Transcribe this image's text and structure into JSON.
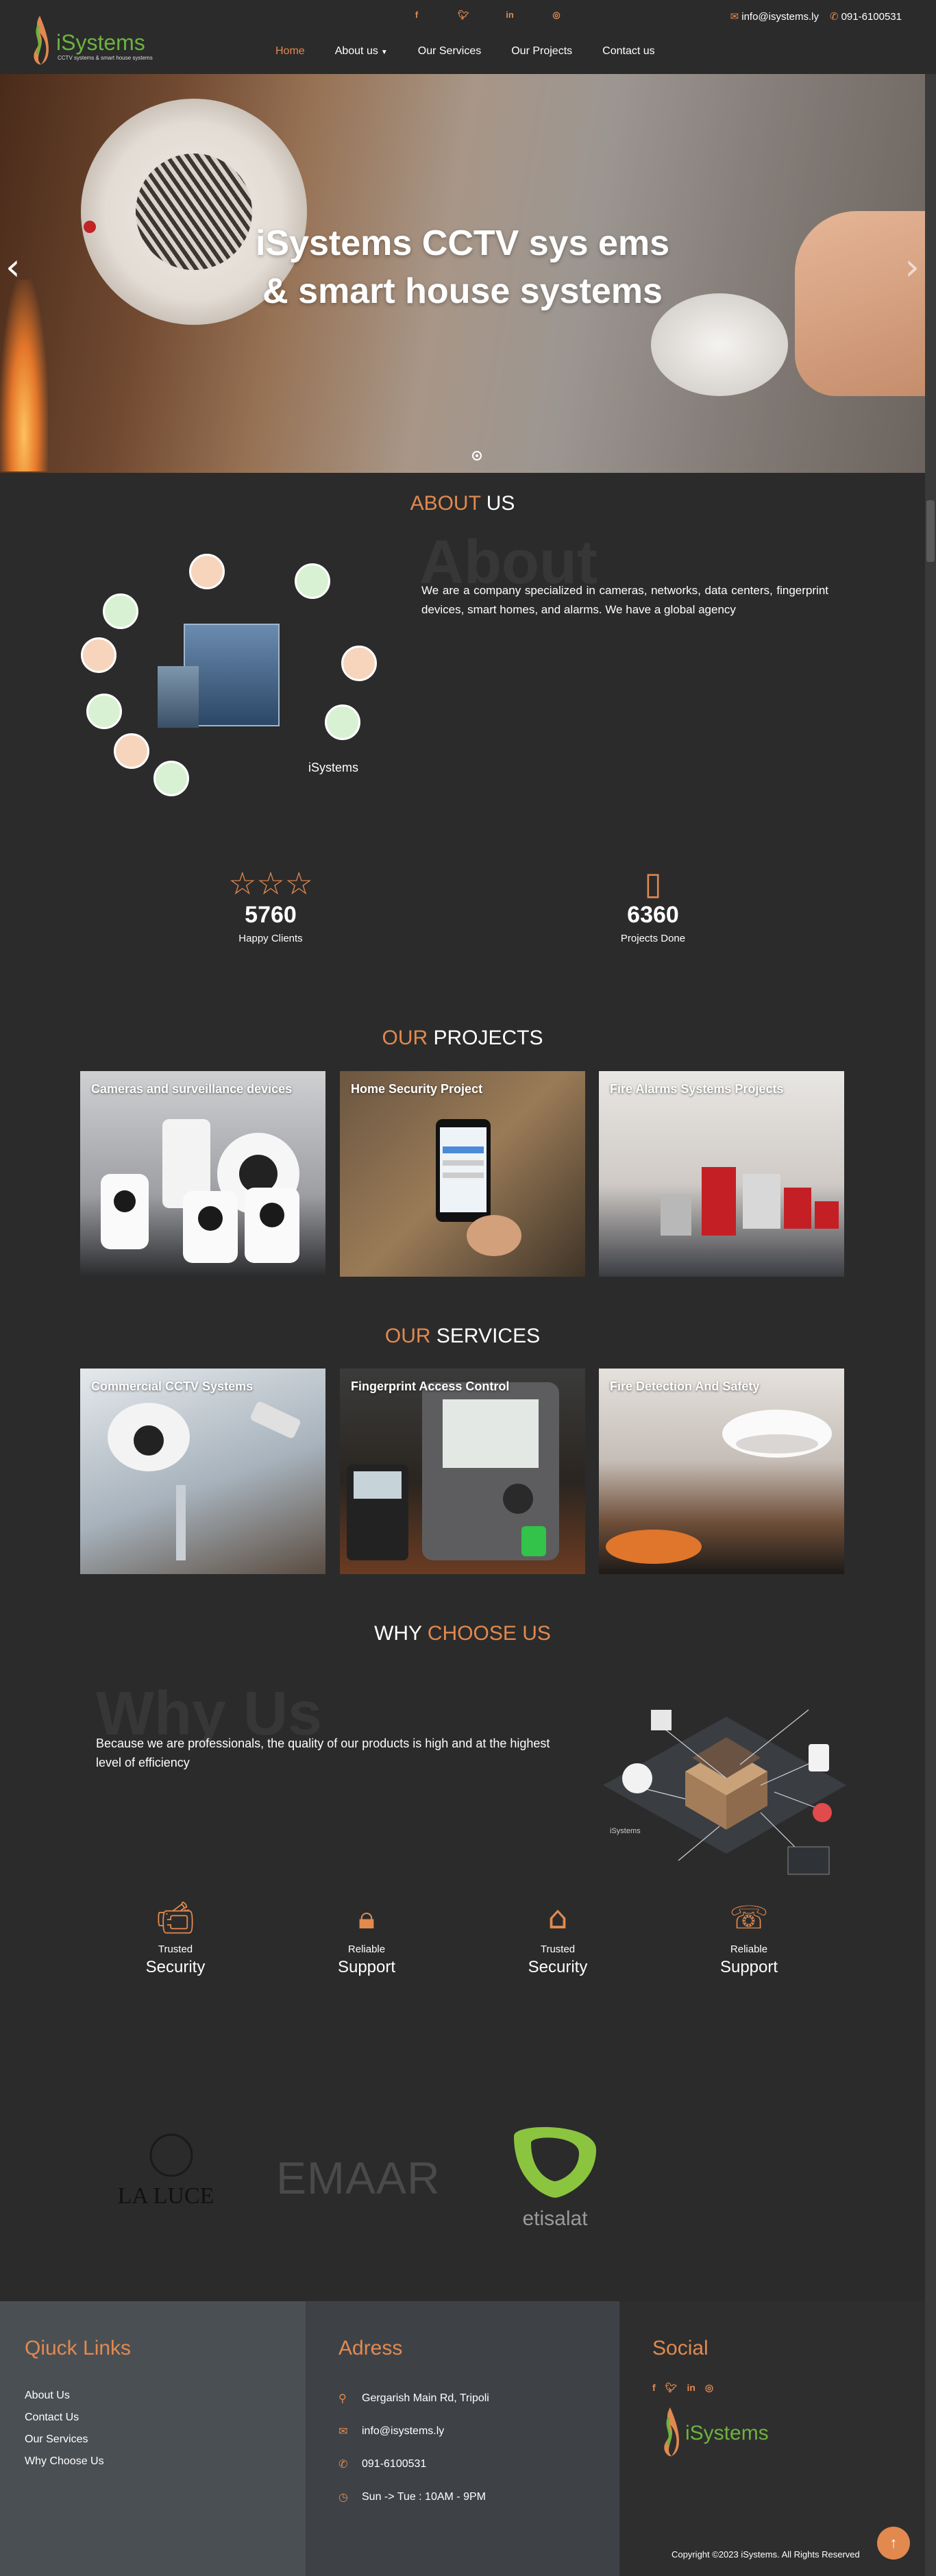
{
  "brand": {
    "name": "iSystems",
    "tagline": "CCTV systems & smart house systems"
  },
  "topbar": {
    "socials": [
      "f",
      "t",
      "in",
      "ig"
    ],
    "email": "info@isystems.ly",
    "phone": "091-6100531"
  },
  "nav": {
    "items": [
      {
        "label": "Home",
        "active": true
      },
      {
        "label": "About us",
        "dropdown": true
      },
      {
        "label": "Our Services"
      },
      {
        "label": "Our Projects"
      },
      {
        "label": "Contact us"
      }
    ]
  },
  "hero": {
    "line1": "iSystems CCTV sys ems",
    "line2": "& smart house systems",
    "prev": "‹",
    "next": "›"
  },
  "about": {
    "title_a": "ABOUT",
    "title_b": " US",
    "ghost": "About",
    "text": "We are a company specialized in cameras, networks, data centers, fingerprint devices, smart homes, and alarms. We have a global agency",
    "brand": "iSystems"
  },
  "stats": [
    {
      "value": "5760",
      "label": "Happy Clients",
      "icon": "users-stars-icon"
    },
    {
      "value": "6360",
      "label": "Projects Done",
      "icon": "door-access-icon"
    }
  ],
  "projects": {
    "title_a": "OUR",
    "title_b": " PROJECTS",
    "items": [
      {
        "label": "Cameras and surveillance devices"
      },
      {
        "label": "Home Security Project"
      },
      {
        "label": "Fire Alarms Systems Projects"
      }
    ]
  },
  "services": {
    "title_a": "OUR",
    "title_b": " SERVICES",
    "items": [
      {
        "label": "Commercial CCTV Systems"
      },
      {
        "label": "Fingerprint Access Control"
      },
      {
        "label": "Fire Detection And Safety"
      }
    ]
  },
  "why": {
    "title_a": "WHY",
    "title_b": " CHOOSE US",
    "ghost": "Why Us",
    "text": "Because we are professionals, the quality of our products is high and at the highest level of efficiency",
    "features": [
      {
        "t1": "Trusted",
        "t2": "Security",
        "icon": "cctv-camera-icon"
      },
      {
        "t1": "Reliable",
        "t2": "Support",
        "icon": "phone-lock-icon"
      },
      {
        "t1": "Trusted",
        "t2": "Security",
        "icon": "smart-home-icon"
      },
      {
        "t1": "Reliable",
        "t2": "Support",
        "icon": "support-24-icon"
      }
    ]
  },
  "partners": [
    {
      "name": "LA LUCE"
    },
    {
      "name": "EMAAR"
    },
    {
      "name": "etisalat"
    }
  ],
  "footer": {
    "links_title": "Qiuck Links",
    "links": [
      "About Us",
      "Contact Us",
      "Our Services",
      "Why Choose Us"
    ],
    "address_title": "Adress",
    "address": [
      {
        "icon": "location-icon",
        "text": "Gergarish Main Rd, Tripoli"
      },
      {
        "icon": "email-icon",
        "text": "info@isystems.ly"
      },
      {
        "icon": "phone-icon",
        "text": "091-6100531"
      },
      {
        "icon": "clock-icon",
        "text": "Sun -> Tue : 10AM - 9PM"
      }
    ],
    "social_title": "Social",
    "socials": [
      "f",
      "t",
      "in",
      "ig"
    ],
    "brand": "iSystems",
    "copyright": "Copyright ©2023 iSystems. All Rights Reserved"
  },
  "colors": {
    "accent": "#e2894f",
    "bg": "#2b2b2b",
    "brand_green": "#6cb33f"
  }
}
